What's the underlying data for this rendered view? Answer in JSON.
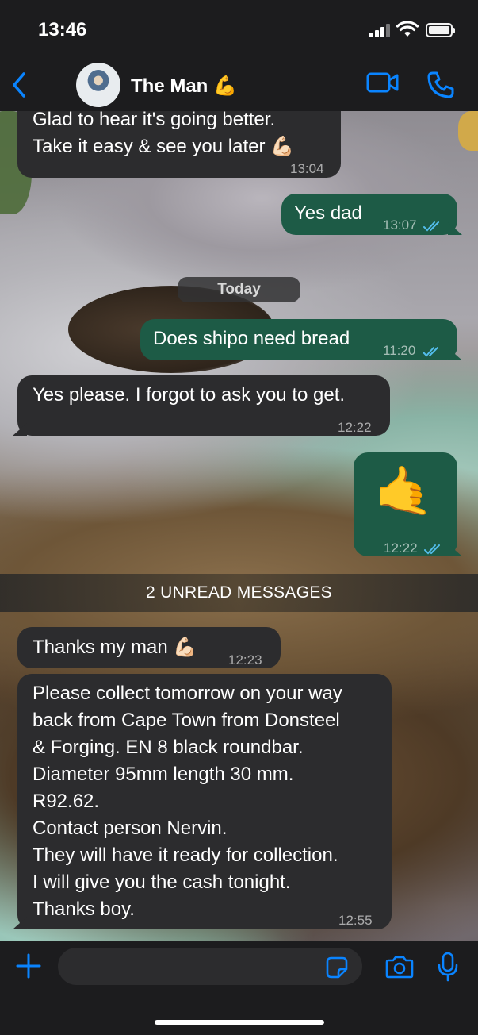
{
  "status_bar": {
    "time": "13:46"
  },
  "header": {
    "contact_name": "The Man 💪"
  },
  "date_divider": "Today",
  "unread_divider": "2 UNREAD MESSAGES",
  "messages": [
    {
      "direction": "in",
      "lines": [
        "Glad to hear it's going better.",
        "Take it easy & see you later 💪🏻"
      ],
      "time": "13:04"
    },
    {
      "direction": "out",
      "text": "Yes dad",
      "time": "13:07",
      "status": "read"
    },
    {
      "direction": "out",
      "text": "Does shipo need bread",
      "time": "11:20",
      "status": "read"
    },
    {
      "direction": "in",
      "text": "Yes please. I forgot to ask you to get.",
      "time": "12:22"
    },
    {
      "direction": "out",
      "emoji": "🤙",
      "time": "12:22",
      "status": "read"
    },
    {
      "direction": "in",
      "text": "Thanks my man 💪🏻",
      "time": "12:23"
    },
    {
      "direction": "in",
      "lines": [
        "Please collect tomorrow on your way",
        "back from Cape Town from Donsteel",
        "& Forging. EN 8 black roundbar.",
        "Diameter 95mm length 30 mm.",
        "R92.62.",
        "Contact person Nervin.",
        "They will have it ready for collection.",
        "I will give you the cash tonight.",
        "Thanks boy."
      ],
      "time": "12:55"
    }
  ],
  "composer": {
    "value": "",
    "placeholder": ""
  },
  "colors": {
    "accent": "#0a84ff",
    "outgoing_bubble": "#1d5b46",
    "incoming_bubble": "#2c2c2e",
    "read_ticks": "#53bdeb"
  },
  "icons": [
    "back-chevron-icon",
    "video-call-icon",
    "phone-icon",
    "plus-icon",
    "sticker-icon",
    "camera-icon",
    "microphone-icon"
  ]
}
